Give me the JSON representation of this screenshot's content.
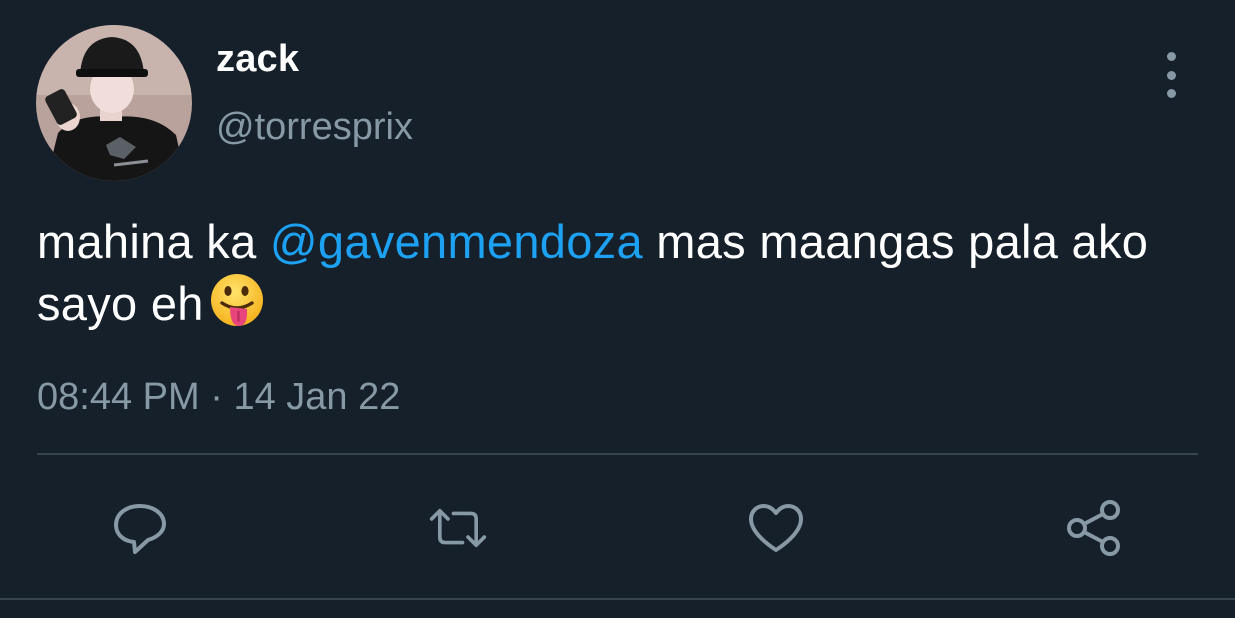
{
  "author": {
    "display_name": "zack",
    "handle": "@torresprix",
    "avatar_icon": "profile-photo"
  },
  "tweet": {
    "text_before": "mahina ka ",
    "mention": "@gavenmendoza",
    "text_after": " mas maangas pala ako sayo eh",
    "emoji_icon": "face-with-tongue-emoji",
    "time": "08:44 PM",
    "separator": " · ",
    "date": "14 Jan 22"
  },
  "actions": {
    "reply_icon": "reply-icon",
    "retweet_icon": "retweet-icon",
    "like_icon": "heart-icon",
    "share_icon": "share-icon",
    "more_icon": "more-vertical-icon"
  },
  "colors": {
    "background": "#15202b",
    "text": "#ffffff",
    "secondary_text": "#8899a6",
    "mention": "#1da1f2",
    "divider": "#38444d"
  }
}
